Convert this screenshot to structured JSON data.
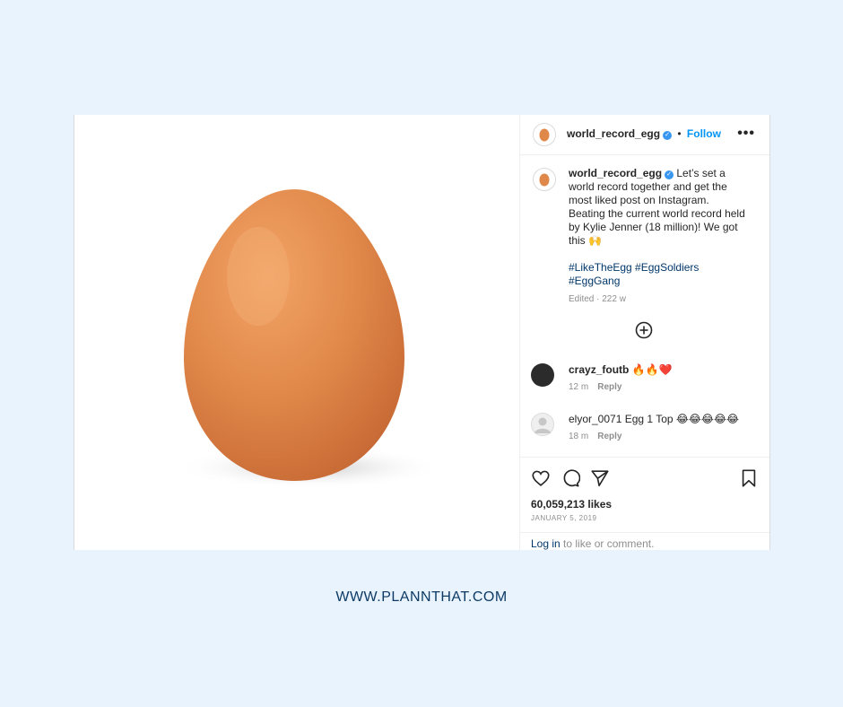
{
  "post": {
    "username": "world_record_egg",
    "verified_icon": "verified-badge-icon",
    "follow_separator": "•",
    "follow_label": "Follow",
    "more_label": "•••",
    "caption_text": "Let’s set a world record together and get the most liked post on Instagram. Beating the current world record held by Kylie Jenner (18 million)! We got this 🙌",
    "hashtags": "#LikeTheEgg #EggSoldiers #EggGang",
    "edited_meta": "Edited · 222 w",
    "comments": [
      {
        "username": "crayz_foutb",
        "text": "🔥🔥❤️",
        "time": "12 m",
        "reply": "Reply"
      },
      {
        "username": "elyor_0071",
        "text": "Egg 1 Top 😂😂😂😂😂",
        "time": "18 m",
        "reply": "Reply"
      }
    ],
    "likes": "60,059,213 likes",
    "date": "JANUARY 5, 2019",
    "login_link": "Log in",
    "login_rest": " to like or comment."
  },
  "footer": {
    "url": "WWW.PLANNTHAT.COM"
  },
  "colors": {
    "background": "#e8f3fd",
    "accent": "#0095f6",
    "hashtag": "#00376b",
    "footer": "#0d3b66",
    "egg": "#e08a4a"
  }
}
